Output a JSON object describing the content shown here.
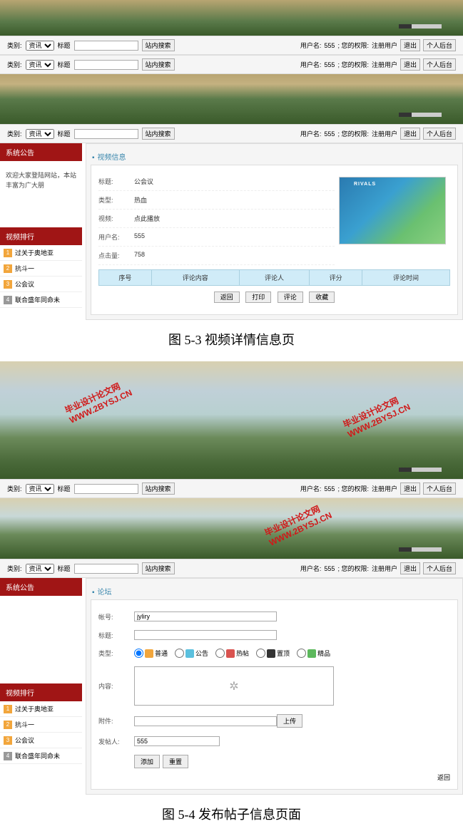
{
  "search": {
    "cat_label": "类别:",
    "cat_value": "资讯",
    "tag_label": "标题",
    "search_btn": "站内搜索",
    "user_prefix": "用户名:",
    "username": "555",
    "role_prefix": "; 您的权限:",
    "role": "注册用户",
    "logout": "退出",
    "personal": "个人后台"
  },
  "announce": {
    "title": "系统公告",
    "body": "欢迎大家登陆网站，本站丰富为广大朋"
  },
  "rank": {
    "title": "视频排行",
    "items": [
      {
        "n": "1",
        "t": "过关于奥地亚"
      },
      {
        "n": "2",
        "t": "抗斗一"
      },
      {
        "n": "3",
        "t": "公会议"
      },
      {
        "n": "4",
        "t": "联合盛年同命未"
      }
    ]
  },
  "rank2": {
    "items": [
      {
        "n": "1",
        "t": "过关于奥地亚"
      },
      {
        "n": "2",
        "t": "抗斗一"
      },
      {
        "n": "3",
        "t": "公会议"
      },
      {
        "n": "4",
        "t": "联合盛年同命未"
      }
    ]
  },
  "detail": {
    "panel_title": "视频信息",
    "rows": {
      "title_k": "标题:",
      "title_v": "公会议",
      "cat_k": "类型:",
      "cat_v": "热血",
      "video_k": "视频:",
      "video_v": "点此播放",
      "user_k": "用户名:",
      "user_v": "555",
      "click_k": "点击量:",
      "click_v": "758"
    },
    "table": [
      "序号",
      "评论内容",
      "评论人",
      "评分",
      "评论时间"
    ],
    "btns": [
      "返回",
      "打印",
      "评论",
      "收藏"
    ]
  },
  "caption1": "图 5-3  视频详情信息页",
  "post": {
    "panel_title": "论坛",
    "account_k": "帐号:",
    "account_v": "jyliry",
    "title_k": "标题:",
    "title_v": "",
    "cat_k": "类型:",
    "cats": [
      "普通",
      "公告",
      "热帖",
      "置顶",
      "精品"
    ],
    "content_k": "内容:",
    "attach_k": "附件:",
    "attach_btn": "上传",
    "poster_k": "发帖人:",
    "poster_v": "555",
    "btns": [
      "添加",
      "重置"
    ],
    "back": "返回"
  },
  "caption2": "图 5-4 发布帖子信息页面",
  "watermark": {
    "url": "WWW.2BYSJ.CN",
    "name": "毕业设计论文网"
  }
}
